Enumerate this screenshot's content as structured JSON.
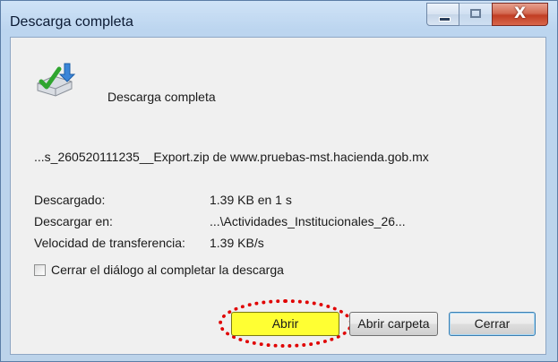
{
  "window": {
    "title": "Descarga completa"
  },
  "heading": "Descarga completa",
  "file_line": "...s_260520111235__Export.zip de www.pruebas-mst.hacienda.gob.mx",
  "details": [
    {
      "label": "Descargado:",
      "value": "1.39 KB en 1 s"
    },
    {
      "label": "Descargar en:",
      "value": "...\\Actividades_Institucionales_26..."
    },
    {
      "label": "Velocidad de transferencia:",
      "value": "1.39 KB/s"
    }
  ],
  "checkbox": {
    "label": "Cerrar el diálogo al completar la descarga",
    "checked": false
  },
  "buttons": {
    "open": "Abrir",
    "open_folder": "Abrir carpeta",
    "close": "Cerrar"
  },
  "titlebar_buttons": {
    "close_glyph": "X"
  },
  "colors": {
    "highlight": "#ffff33",
    "annotation": "#e00000",
    "title_bar": "#bcd5ef"
  }
}
